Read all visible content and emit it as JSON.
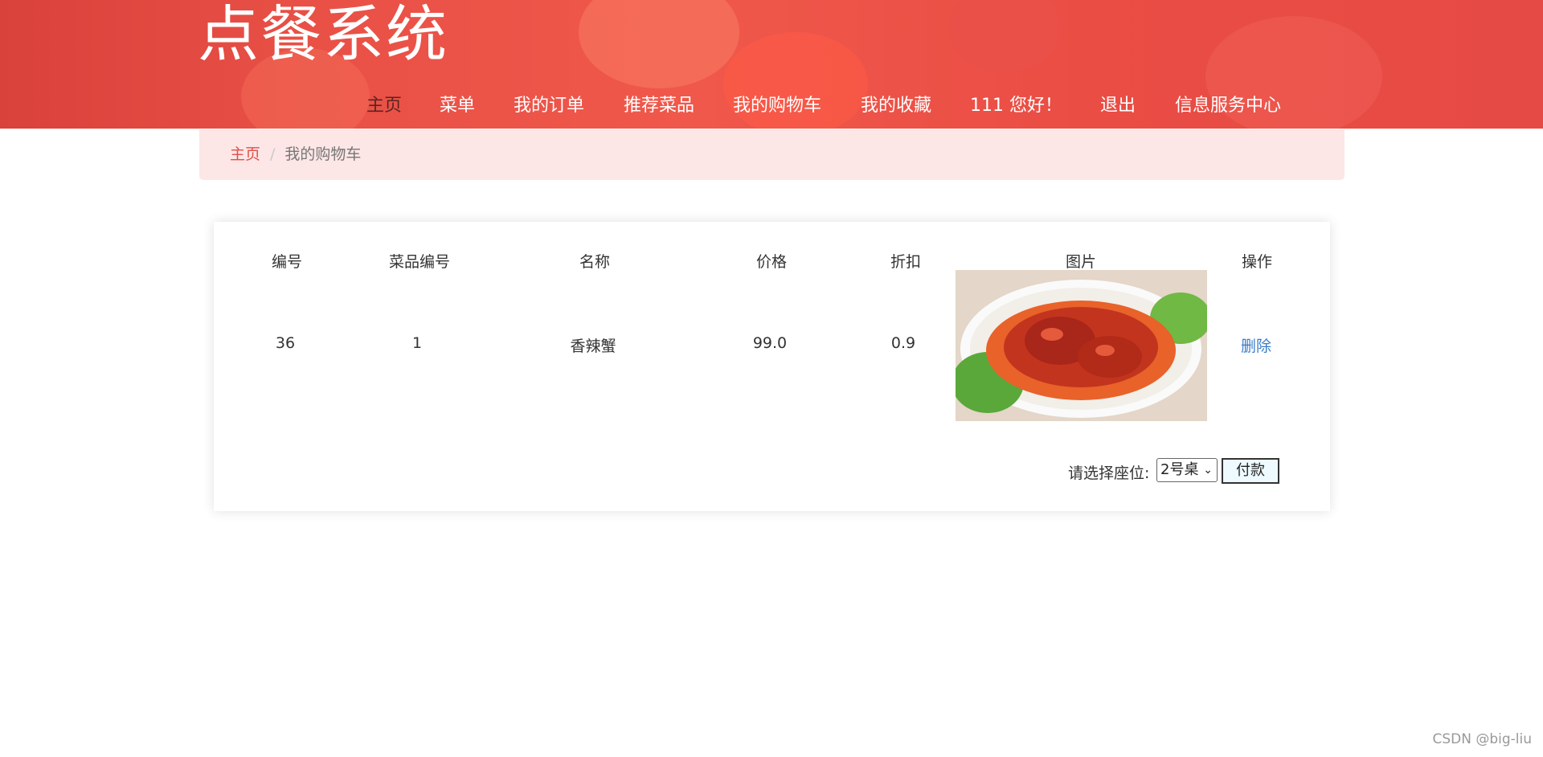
{
  "header": {
    "title": "点餐系统",
    "nav": [
      {
        "label": "主页"
      },
      {
        "label": "菜单"
      },
      {
        "label": "我的订单"
      },
      {
        "label": "推荐菜品"
      },
      {
        "label": "我的购物车"
      },
      {
        "label": "我的收藏"
      },
      {
        "label": "111 您好！"
      },
      {
        "label": "退出"
      },
      {
        "label": "信息服务中心"
      }
    ]
  },
  "breadcrumb": {
    "home": "主页",
    "separator": "/",
    "current": "我的购物车"
  },
  "cart": {
    "columns": [
      "编号",
      "菜品编号",
      "名称",
      "价格",
      "折扣",
      "图片",
      "操作"
    ],
    "rows": [
      {
        "id": "36",
        "dish_id": "1",
        "name": "香辣蟹",
        "price": "99.0",
        "discount": "0.9",
        "action": "删除"
      }
    ],
    "seat_label": "请选择座位:",
    "seat_selected": "2号桌",
    "pay_label": "付款"
  },
  "watermark": "CSDN @big-liu",
  "colors": {
    "header_red": "#e95046",
    "breadcrumb_bg": "#fde6e6",
    "link_red": "#e0504a",
    "link_blue": "#3a7bc8"
  }
}
